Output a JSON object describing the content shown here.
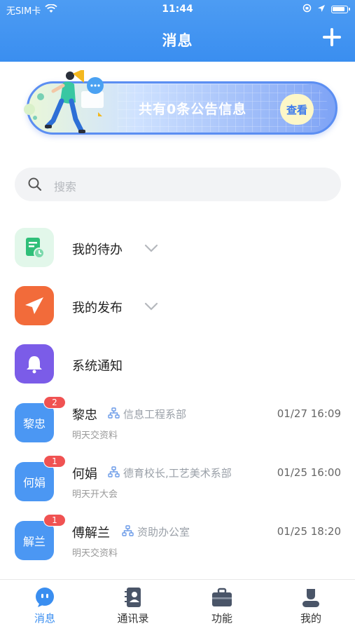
{
  "status_bar": {
    "carrier": "无SIM卡",
    "time": "11:44"
  },
  "header": {
    "title": "消息"
  },
  "banner": {
    "text": "共有0条公告信息",
    "button": "查看"
  },
  "search": {
    "placeholder": "搜索"
  },
  "entries": [
    {
      "label": "我的待办",
      "icon": "todo-icon",
      "color": "#e2f7ea"
    },
    {
      "label": "我的发布",
      "icon": "paper-plane-icon",
      "color": "#f26b3a"
    },
    {
      "label": "系统通知",
      "icon": "bell-icon",
      "color": "#7b5ce8"
    }
  ],
  "messages": [
    {
      "avatar": "黎忠",
      "badge": "2",
      "name": "黎忠",
      "dept": "信息工程系部",
      "time": "01/27 16:09",
      "preview": "明天交资料"
    },
    {
      "avatar": "何娟",
      "badge": "1",
      "name": "何娟",
      "dept": "德育校长,工艺美术系部",
      "time": "01/25 16:00",
      "preview": "明天开大会"
    },
    {
      "avatar": "解兰",
      "badge": "1",
      "name": "傅解兰",
      "dept": "资助办公室",
      "time": "01/25 18:20",
      "preview": "明天交资料"
    }
  ],
  "tabbar": {
    "tabs": [
      {
        "label": "消息",
        "icon": "chat-bubble-icon",
        "active": true
      },
      {
        "label": "通讯录",
        "icon": "contacts-book-icon",
        "active": false
      },
      {
        "label": "功能",
        "icon": "briefcase-icon",
        "active": false
      },
      {
        "label": "我的",
        "icon": "user-icon",
        "active": false
      }
    ]
  },
  "colors": {
    "primary": "#3a8ef0",
    "badge": "#f05252",
    "avatar": "#4b97f3"
  }
}
